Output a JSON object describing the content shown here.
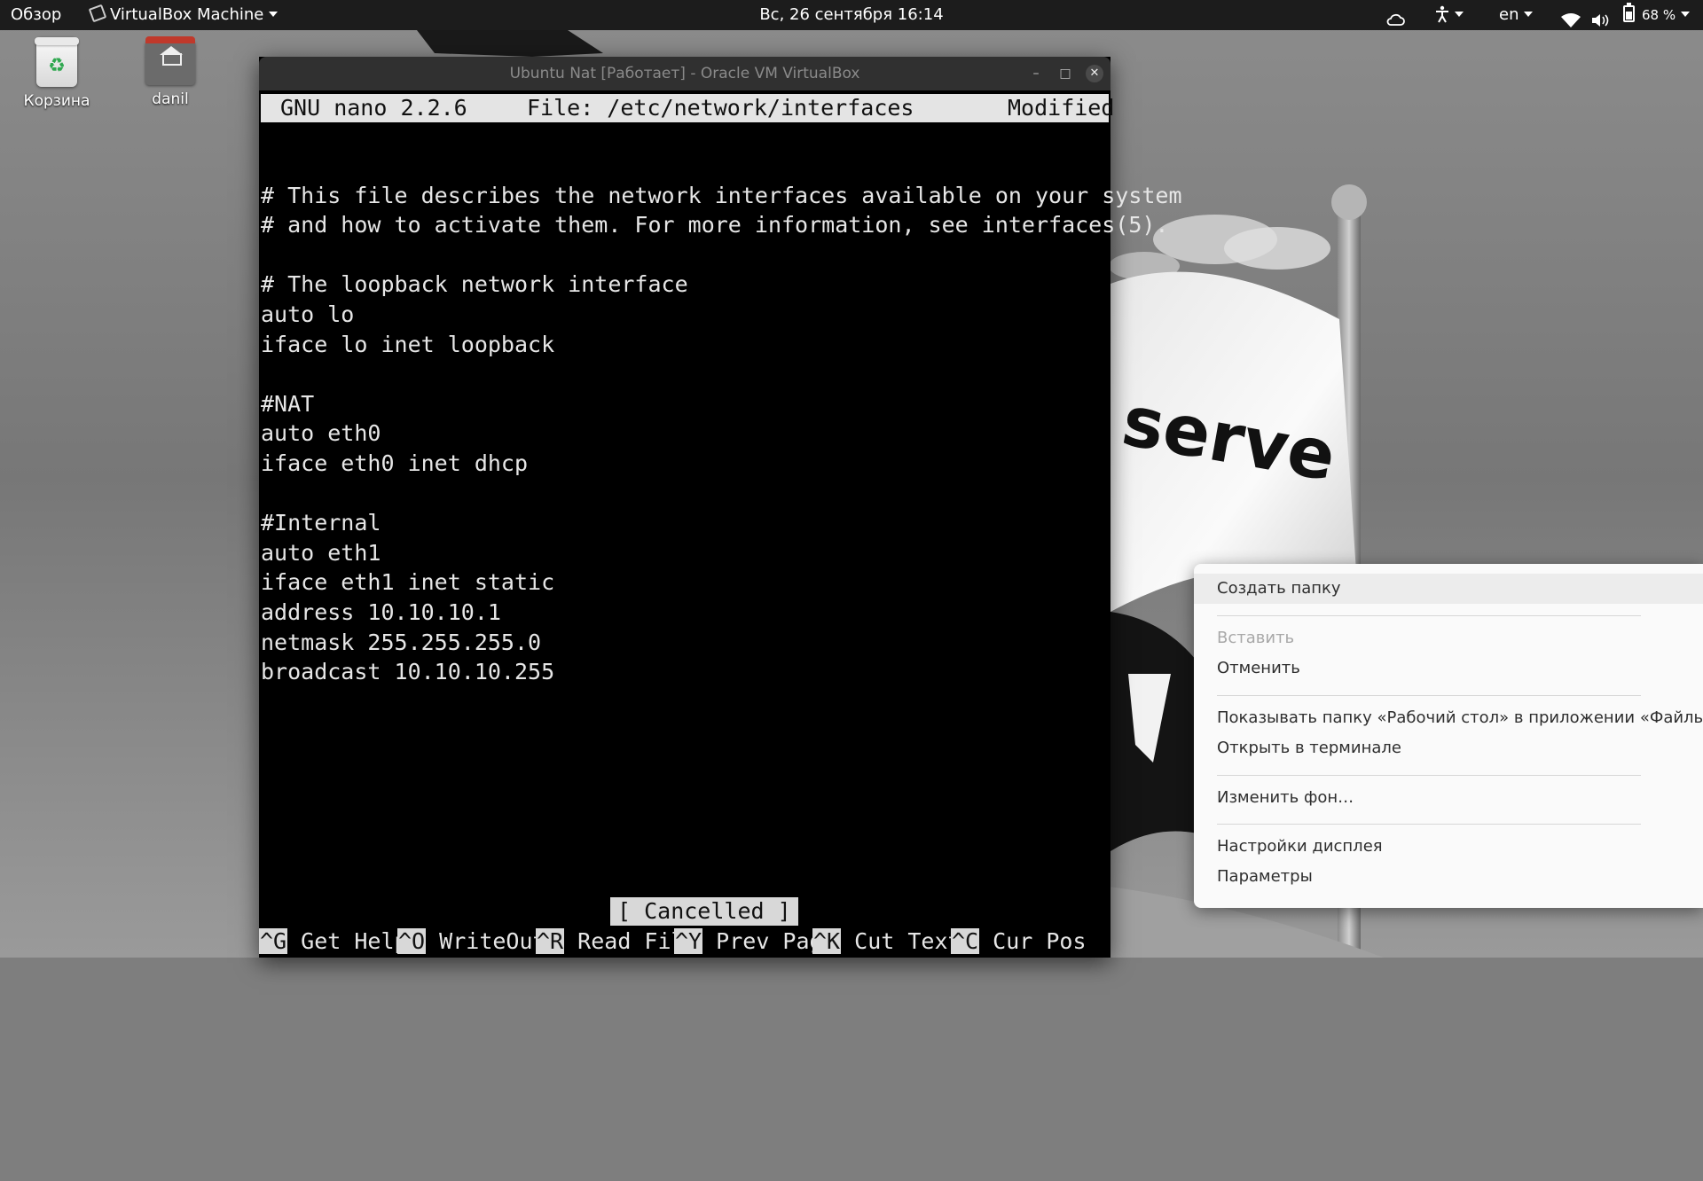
{
  "topbar": {
    "activities": "Обзор",
    "app_name": "VirtualBox Machine",
    "clock": "Вс, 26 сентября  16:14",
    "language": "en",
    "battery": "68 %"
  },
  "desktop": {
    "icons": [
      {
        "label": "Корзина"
      },
      {
        "label": "danil"
      }
    ],
    "wallpaper_text": "serve"
  },
  "vbox_window": {
    "title": "Ubuntu Nat [Работает] - Oracle VM VirtualBox"
  },
  "nano": {
    "version": "GNU nano 2.2.6",
    "file": "File: /etc/network/interfaces",
    "state": "Modified",
    "lines": [
      "",
      "# This file describes the network interfaces available on your system",
      "# and how to activate them. For more information, see interfaces(5).",
      "",
      "# The loopback network interface",
      "auto lo",
      "iface lo inet loopback",
      "",
      "#NAT",
      "auto eth0",
      "iface eth0 inet dhcp",
      "",
      "#Internal",
      "auto eth1",
      "iface eth1 inet static",
      "address 10.10.10.1",
      "netmask 255.255.255.0",
      "broadcast 10.10.10.255"
    ],
    "status": "[ Cancelled ]",
    "shortcuts": [
      {
        "key": "^G",
        "label": "Get Help"
      },
      {
        "key": "^O",
        "label": "WriteOut"
      },
      {
        "key": "^R",
        "label": "Read File"
      },
      {
        "key": "^Y",
        "label": "Prev Page"
      },
      {
        "key": "^K",
        "label": "Cut Text"
      },
      {
        "key": "^C",
        "label": "Cur Pos"
      }
    ]
  },
  "context_menu": {
    "new_folder": "Создать папку",
    "paste": "Вставить",
    "undo": "Отменить",
    "show_in_files": "Показывать папку «Рабочий стол» в приложении «Файлы»",
    "open_terminal": "Открыть в терминале",
    "change_background": "Изменить фон…",
    "display_settings": "Настройки дисплея",
    "settings": "Параметры"
  }
}
